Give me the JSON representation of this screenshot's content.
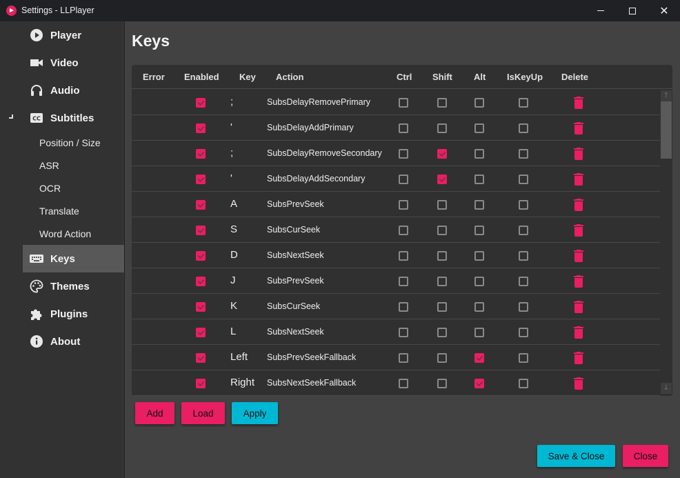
{
  "window": {
    "title": "Settings - LLPlayer",
    "controls": {
      "minimize": "minimize",
      "maximize": "maximize",
      "close": "✕"
    }
  },
  "sidebar": {
    "items": [
      {
        "label": "Player",
        "icon": "play-circle-icon"
      },
      {
        "label": "Video",
        "icon": "video-camera-icon"
      },
      {
        "label": "Audio",
        "icon": "headphones-icon"
      },
      {
        "label": "Subtitles",
        "icon": "closed-caption-icon",
        "expanded": true,
        "children": [
          {
            "label": "Position / Size"
          },
          {
            "label": "ASR"
          },
          {
            "label": "OCR"
          },
          {
            "label": "Translate"
          },
          {
            "label": "Word Action"
          }
        ]
      },
      {
        "label": "Keys",
        "icon": "keyboard-icon",
        "active": true
      },
      {
        "label": "Themes",
        "icon": "palette-icon"
      },
      {
        "label": "Plugins",
        "icon": "puzzle-icon"
      },
      {
        "label": "About",
        "icon": "info-icon"
      }
    ]
  },
  "main": {
    "title": "Keys",
    "columns": [
      "Error",
      "Enabled",
      "Key",
      "Action",
      "Ctrl",
      "Shift",
      "Alt",
      "IsKeyUp",
      "Delete"
    ],
    "rows": [
      {
        "error": "",
        "enabled": true,
        "key": ";",
        "action": "SubsDelayRemovePrimary",
        "ctrl": false,
        "shift": false,
        "alt": false,
        "iskeyup": false
      },
      {
        "error": "",
        "enabled": true,
        "key": "'",
        "action": "SubsDelayAddPrimary",
        "ctrl": false,
        "shift": false,
        "alt": false,
        "iskeyup": false
      },
      {
        "error": "",
        "enabled": true,
        "key": ";",
        "action": "SubsDelayRemoveSecondary",
        "ctrl": false,
        "shift": true,
        "alt": false,
        "iskeyup": false
      },
      {
        "error": "",
        "enabled": true,
        "key": "'",
        "action": "SubsDelayAddSecondary",
        "ctrl": false,
        "shift": true,
        "alt": false,
        "iskeyup": false
      },
      {
        "error": "",
        "enabled": true,
        "key": "A",
        "action": "SubsPrevSeek",
        "ctrl": false,
        "shift": false,
        "alt": false,
        "iskeyup": false
      },
      {
        "error": "",
        "enabled": true,
        "key": "S",
        "action": "SubsCurSeek",
        "ctrl": false,
        "shift": false,
        "alt": false,
        "iskeyup": false
      },
      {
        "error": "",
        "enabled": true,
        "key": "D",
        "action": "SubsNextSeek",
        "ctrl": false,
        "shift": false,
        "alt": false,
        "iskeyup": false
      },
      {
        "error": "",
        "enabled": true,
        "key": "J",
        "action": "SubsPrevSeek",
        "ctrl": false,
        "shift": false,
        "alt": false,
        "iskeyup": false
      },
      {
        "error": "",
        "enabled": true,
        "key": "K",
        "action": "SubsCurSeek",
        "ctrl": false,
        "shift": false,
        "alt": false,
        "iskeyup": false
      },
      {
        "error": "",
        "enabled": true,
        "key": "L",
        "action": "SubsNextSeek",
        "ctrl": false,
        "shift": false,
        "alt": false,
        "iskeyup": false
      },
      {
        "error": "",
        "enabled": true,
        "key": "Left",
        "action": "SubsPrevSeekFallback",
        "ctrl": false,
        "shift": false,
        "alt": true,
        "iskeyup": false
      },
      {
        "error": "",
        "enabled": true,
        "key": "Right",
        "action": "SubsNextSeekFallback",
        "ctrl": false,
        "shift": false,
        "alt": true,
        "iskeyup": false
      }
    ],
    "buttons": {
      "add": "Add",
      "load": "Load",
      "apply": "Apply"
    },
    "footer": {
      "save_close": "Save & Close",
      "close": "Close"
    }
  },
  "colors": {
    "accent_pink": "#e91e63",
    "accent_cyan": "#00b8d4"
  }
}
